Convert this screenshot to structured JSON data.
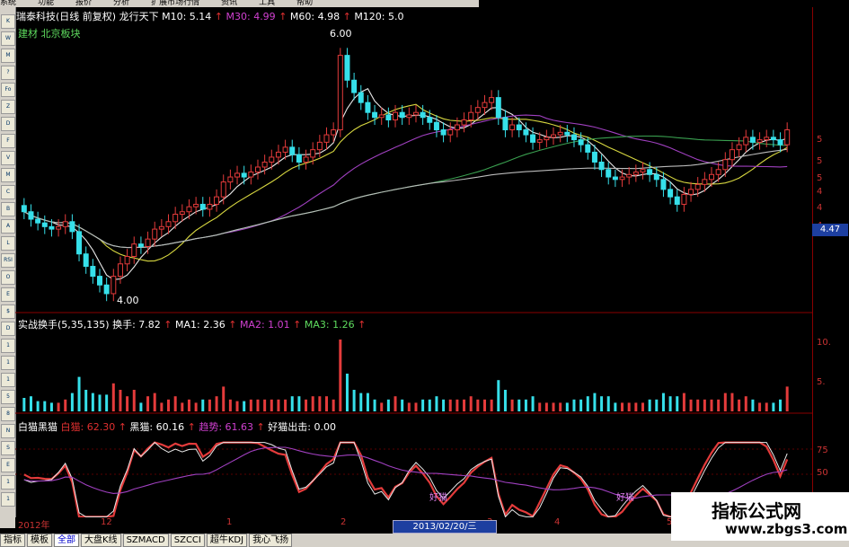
{
  "menubar": [
    "系统",
    "功能",
    "报价",
    "分析",
    "扩展市场行情",
    "资讯",
    "工具",
    "帮助"
  ],
  "header": {
    "title": "瑞泰科技(日线 前复权)",
    "indicator": "龙行天下",
    "ma10": "M10: 5.14",
    "ma30": "M30: 4.99",
    "ma60": "M60: 4.98",
    "ma120": "M120: 5.0",
    "sub": "建材 北京板块"
  },
  "annotations": {
    "high": "6.00",
    "low": "4.00"
  },
  "price_tag": "4.47",
  "panel2": {
    "name": "实战换手(5,35,135)",
    "hs": "换手: 7.82",
    "ma1": "MA1: 2.36",
    "ma2": "MA2: 1.01",
    "ma3": "MA3: 1.26"
  },
  "panel3": {
    "name": "白猫黑猫",
    "bai": "白猫: 62.30",
    "hei": "黑猫: 60.16",
    "qushi": "趋势: 61.63",
    "chuji": "好猫出击: 0.00",
    "signal1": "好猫",
    "signal2": "好猫"
  },
  "axis": {
    "main": [
      "5",
      "5",
      "5",
      "4",
      "4",
      "4"
    ],
    "vol": [
      "10.",
      "5."
    ],
    "osc": [
      "75",
      "50"
    ]
  },
  "date_axis": [
    "2012年",
    "12",
    "1",
    "2",
    "3",
    "4",
    "5"
  ],
  "date_box": "2013/02/20/三",
  "tabs": [
    "指标",
    "模板",
    "全部",
    "大盘K线",
    "SZMACD",
    "SZCCI",
    "超牛KDJ",
    "我心飞扬"
  ],
  "active_tab": 2,
  "toolbar_icons": [
    "K",
    "W",
    "M",
    "?",
    "Fo",
    "Z",
    "D",
    "F",
    "V",
    "M",
    "C",
    "B",
    "A",
    "L",
    "RSI",
    "O",
    "E",
    "$",
    "D",
    "1",
    "1",
    "1",
    "5",
    "8",
    "N",
    "S",
    "E",
    "1",
    "1"
  ],
  "watermark": {
    "line1": "指标公式网",
    "line2": "www.zbgs3.com"
  },
  "colors": {
    "up": "#e43b3b",
    "down": "#36e0ea",
    "up_alt": "#f0a030",
    "ma_white": "#e8e8e8",
    "ma_purple": "#a040c0",
    "ma_green": "#3aa050",
    "ma_yellow": "#d8d840"
  },
  "chart_data": {
    "type": "candlestick",
    "series": [
      {
        "values": [
          4.69,
          4.64,
          4.58,
          4.55,
          4.52,
          4.5,
          4.52,
          4.56,
          4.48,
          4.3,
          4.2,
          4.12,
          4.05,
          3.98,
          4.12,
          4.22,
          4.28,
          4.38,
          4.36,
          4.42,
          4.5,
          4.52,
          4.56,
          4.62,
          4.64,
          4.68,
          4.7,
          4.66,
          4.7,
          4.76,
          4.88,
          4.92,
          4.95,
          4.92,
          4.96,
          5.0,
          5.04,
          5.08,
          5.12,
          5.16,
          5.1,
          5.04,
          5.08,
          5.14,
          5.2,
          5.26,
          5.3,
          5.9,
          5.7,
          5.6,
          5.52,
          5.44,
          5.4,
          5.42,
          5.38,
          5.44,
          5.4,
          5.42,
          5.44,
          5.4,
          5.36,
          5.3,
          5.26,
          5.3,
          5.34,
          5.38,
          5.44,
          5.48,
          5.52,
          5.56,
          5.4,
          5.3,
          5.34,
          5.3,
          5.26,
          5.2,
          5.22,
          5.24,
          5.26,
          5.28,
          5.26,
          5.22,
          5.18,
          5.12,
          5.04,
          4.98,
          4.92,
          4.9,
          4.92,
          4.94,
          4.96,
          4.98,
          4.94,
          4.9,
          4.82,
          4.76,
          4.7,
          4.78,
          4.82,
          4.86,
          4.9,
          4.94,
          4.98,
          5.06,
          5.14,
          5.18,
          5.24,
          5.2,
          5.22,
          5.24,
          5.22,
          5.18
        ]
      },
      {
        "values": [
          4.64,
          4.58,
          4.55,
          4.52,
          4.5,
          4.52,
          4.56,
          4.48,
          4.3,
          4.2,
          4.12,
          4.05,
          3.98,
          4.12,
          4.22,
          4.28,
          4.38,
          4.36,
          4.42,
          4.5,
          4.52,
          4.56,
          4.62,
          4.64,
          4.68,
          4.7,
          4.66,
          4.7,
          4.76,
          4.88,
          4.92,
          4.95,
          4.92,
          4.96,
          5.0,
          5.04,
          5.08,
          5.12,
          5.16,
          5.1,
          5.04,
          5.08,
          5.14,
          5.2,
          5.26,
          5.3,
          5.9,
          5.7,
          5.6,
          5.52,
          5.44,
          5.4,
          5.42,
          5.38,
          5.44,
          5.4,
          5.42,
          5.44,
          5.4,
          5.36,
          5.3,
          5.26,
          5.3,
          5.34,
          5.38,
          5.44,
          5.48,
          5.52,
          5.56,
          5.4,
          5.3,
          5.34,
          5.3,
          5.26,
          5.2,
          5.22,
          5.24,
          5.26,
          5.28,
          5.26,
          5.22,
          5.18,
          5.12,
          5.04,
          4.98,
          4.92,
          4.9,
          4.92,
          4.94,
          4.96,
          4.98,
          4.94,
          4.9,
          4.82,
          4.76,
          4.7,
          4.78,
          4.82,
          4.86,
          4.9,
          4.94,
          4.98,
          5.06,
          5.14,
          5.18,
          5.24,
          5.2,
          5.22,
          5.24,
          5.22,
          5.18,
          5.3
        ]
      }
    ]
  }
}
